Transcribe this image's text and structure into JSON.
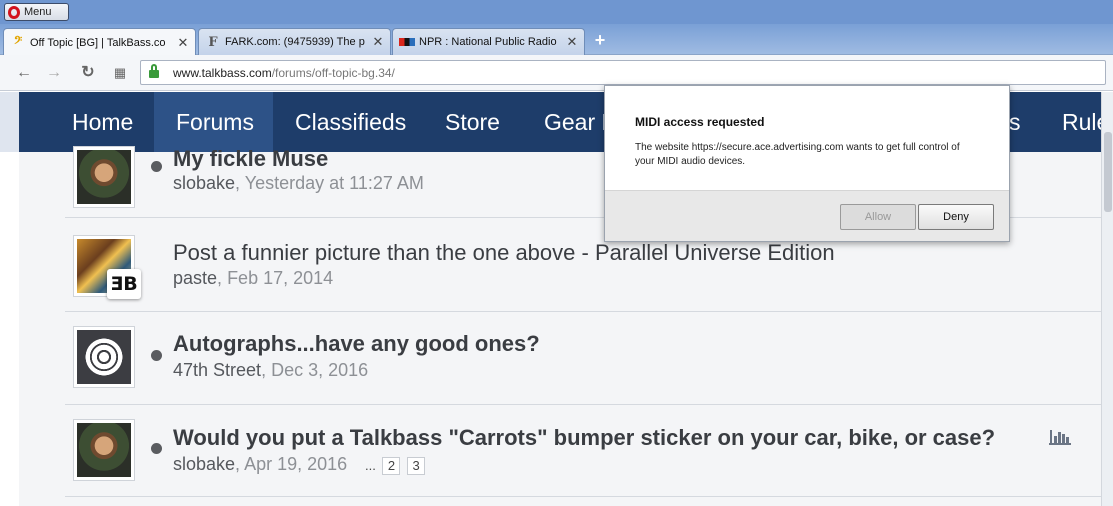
{
  "browser": {
    "menu_label": "Menu",
    "tabs": [
      {
        "title": "Off Topic [BG] | TalkBass.co",
        "active": true
      },
      {
        "title": "FARK.com: (9475939) The p",
        "active": false
      },
      {
        "title": "NPR : National Public Radio",
        "active": false
      }
    ],
    "url_host": "www.talkbass.com",
    "url_path": "/forums/off-topic-bg.34/"
  },
  "site_nav": [
    "Home",
    "Forums",
    "Classifieds",
    "Store",
    "Gear R",
    "s",
    "Rules"
  ],
  "threads": [
    {
      "title": "My fickle Muse",
      "author": "slobake",
      "date": "Yesterday at 11:27 AM"
    },
    {
      "title": "Post a funnier picture than the one above - Parallel Universe Edition",
      "author": "paste",
      "date": "Feb 17, 2014",
      "badge": "ƎB"
    },
    {
      "title": "Autographs...have any good ones?",
      "author": "47th Street",
      "date": "Dec 3, 2016"
    },
    {
      "title": "Would you put a Talkbass \"Carrots\" bumper sticker on your car, bike, or case?",
      "author": "slobake",
      "date": "Apr 19, 2016",
      "ellipsis": "...",
      "pages": [
        "2",
        "3"
      ]
    }
  ],
  "dialog": {
    "title": "MIDI access requested",
    "message": "The website https://secure.ace.advertising.com wants to get full control of your MIDI audio devices.",
    "allow_label": "Allow",
    "deny_label": "Deny"
  }
}
